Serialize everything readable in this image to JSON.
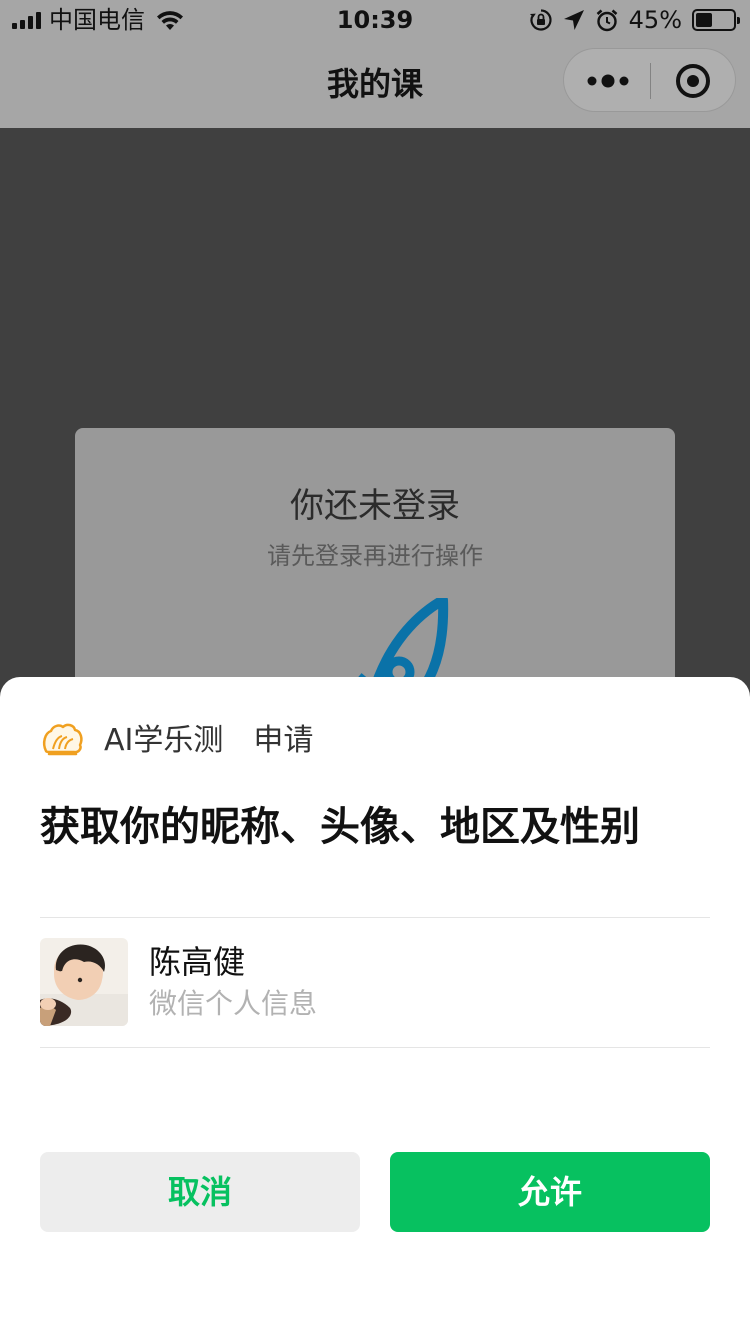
{
  "status_bar": {
    "carrier": "中国电信",
    "time": "10:39",
    "battery_percent_text": "45%",
    "battery_level": 0.45,
    "icons": [
      "signal-icon",
      "wifi-icon",
      "orientation-lock-icon",
      "location-arrow-icon",
      "alarm-icon",
      "battery-icon"
    ]
  },
  "nav": {
    "title": "我的课",
    "capsule_icons": [
      "more-icon",
      "close-miniprogram-icon"
    ]
  },
  "background_card": {
    "title": "你还未登录",
    "subtitle": "请先登录再进行操作",
    "illustration": "rocket-icon"
  },
  "auth_sheet": {
    "app_name": "AI学乐测",
    "action": "申请",
    "title": "获取你的昵称、头像、地区及性别",
    "user": {
      "name": "陈高健",
      "description": "微信个人信息"
    },
    "buttons": {
      "cancel": "取消",
      "allow": "允许"
    }
  },
  "colors": {
    "overlay": "#404040",
    "nav_dimmed": "#a6a6a6",
    "wechat_green": "#07c160",
    "cancel_bg": "#ededed",
    "rocket_blue": "#0a72a8"
  }
}
